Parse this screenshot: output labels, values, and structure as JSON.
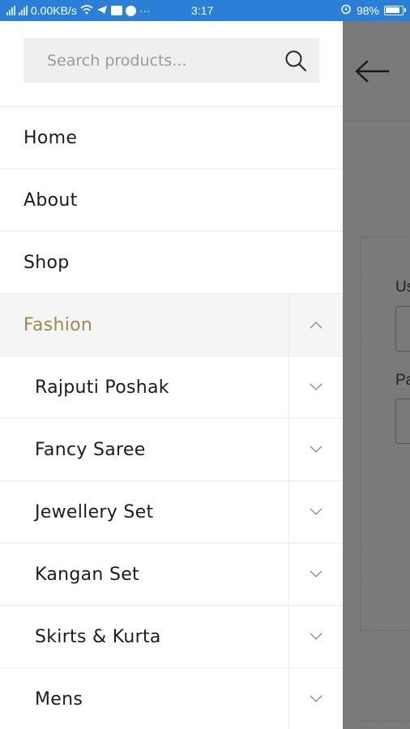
{
  "status_bar": {
    "net_speed": "0.00KB/s",
    "time": "3:17",
    "battery": "98%"
  },
  "search": {
    "placeholder": "Search products...",
    "value": ""
  },
  "menu": {
    "items": [
      {
        "label": "Home"
      },
      {
        "label": "About"
      },
      {
        "label": "Shop"
      }
    ],
    "fashion": {
      "label": "Fashion",
      "expanded": true
    },
    "sub_items": [
      {
        "label": "Rajputi Poshak"
      },
      {
        "label": "Fancy Saree"
      },
      {
        "label": "Jewellery Set"
      },
      {
        "label": "Kangan Set"
      },
      {
        "label": "Skirts & Kurta"
      },
      {
        "label": "Mens"
      }
    ]
  },
  "background_page": {
    "label_1": "Us",
    "label_2": "Pa"
  },
  "colors": {
    "status_bar": "#2b7fd6",
    "active_menu_text": "#9c8a4e",
    "overlay": "#7a7a7a"
  }
}
